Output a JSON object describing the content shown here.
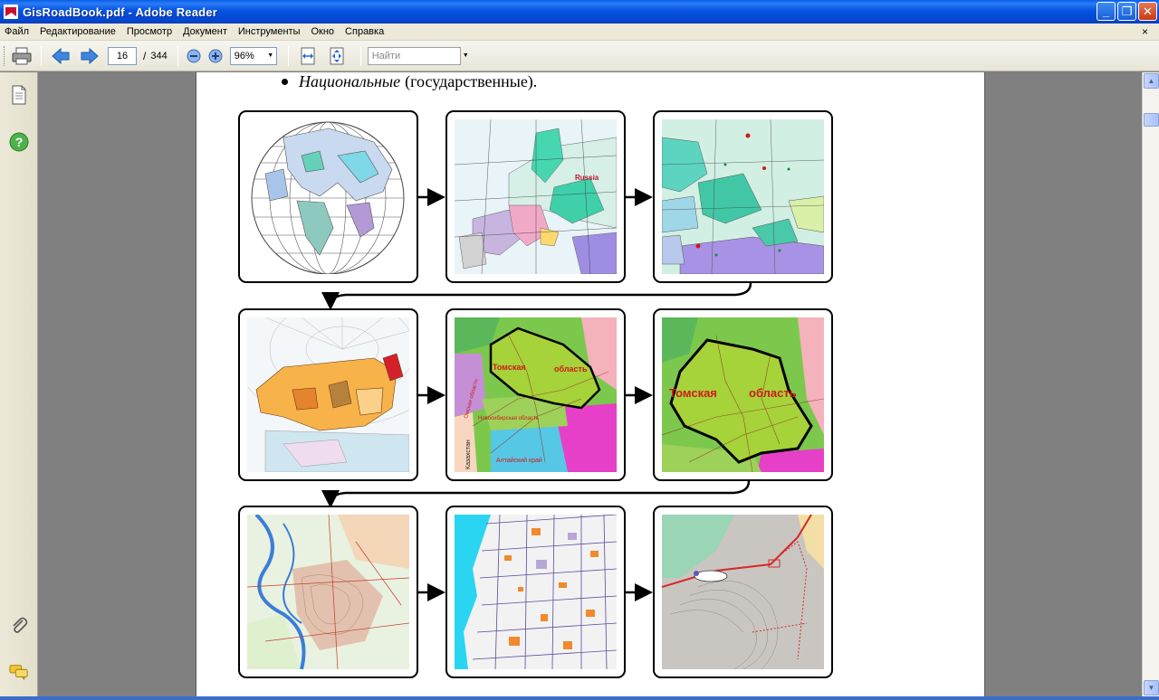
{
  "window": {
    "title": "GisRoadBook.pdf - Adobe Reader",
    "buttons": {
      "minimize": "_",
      "restore": "❐",
      "close": "✕"
    }
  },
  "menu": {
    "items": [
      "Файл",
      "Редактирование",
      "Просмотр",
      "Документ",
      "Инструменты",
      "Окно",
      "Справка"
    ],
    "close_glyph": "×"
  },
  "toolbar": {
    "current_page": "16",
    "page_separator": "/",
    "total_pages": "344",
    "zoom": "96%",
    "find_placeholder": "Найти"
  },
  "document": {
    "bullet_italic": "Национальные",
    "bullet_rest": "(государственные).",
    "map_labels": {
      "russia": "Russia",
      "tomsk_small_1": "Томская",
      "tomsk_small_2": "область",
      "novosibirsk": "Новосибирская область",
      "omsk": "Омская область",
      "kazakhstan": "Казахстан",
      "altai": "Алтайский край",
      "tomsk_large_1": "Томская",
      "tomsk_large_2": "область"
    }
  },
  "colors": {
    "titlebar": "#0553e1",
    "chrome": "#ece9d8",
    "doc_background": "#808080",
    "arrow": "#000000",
    "region_green": "#a6d23a",
    "label_red": "#d11a1a"
  },
  "icons": [
    "print-icon",
    "prev-page-icon",
    "next-page-icon",
    "zoom-out-icon",
    "zoom-in-icon",
    "fit-width-icon",
    "fit-page-icon",
    "pages-icon",
    "help-icon",
    "attachment-icon",
    "comments-icon"
  ]
}
